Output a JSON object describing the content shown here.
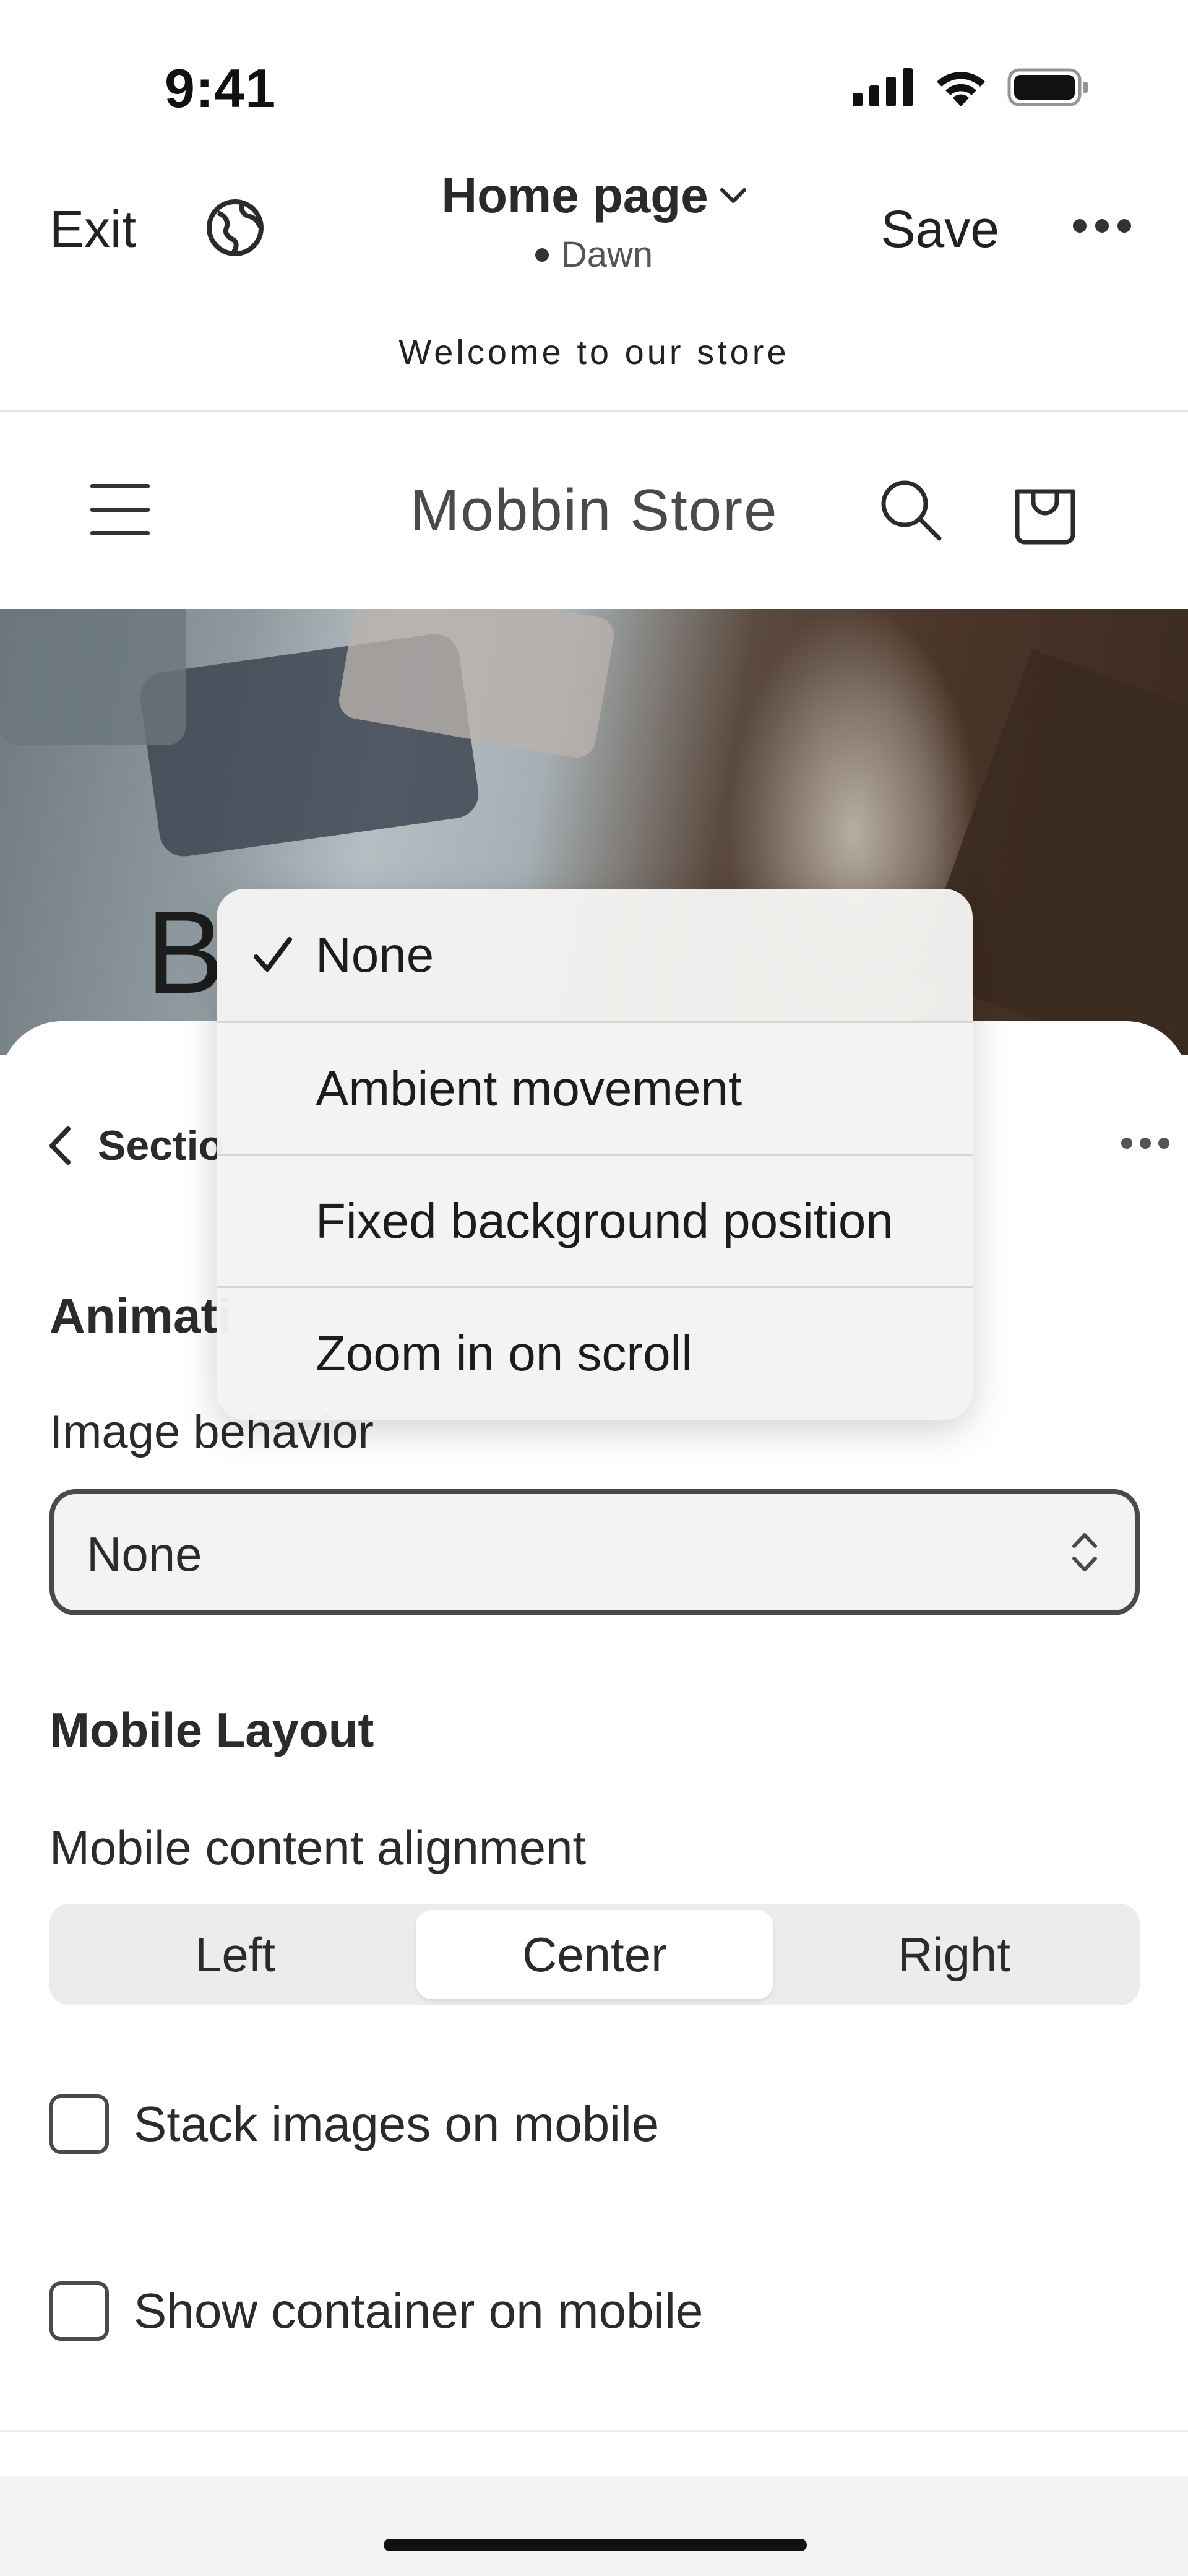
{
  "status_bar": {
    "time": "9:41"
  },
  "editor_bar": {
    "exit_label": "Exit",
    "page_title": "Home page",
    "theme_name": "Dawn",
    "save_label": "Save"
  },
  "store": {
    "announcement": "Welcome to our store",
    "name": "Mobbin Store",
    "hero_partial_text": "B"
  },
  "sheet": {
    "back_label": "Sectio",
    "animation_heading": "Animati",
    "image_behavior_label": "Image behavior",
    "image_behavior_value": "None",
    "mobile_layout_heading": "Mobile Layout",
    "mobile_alignment_label": "Mobile content alignment",
    "alignment_options": [
      "Left",
      "Center",
      "Right"
    ],
    "alignment_selected": "Center",
    "checkboxes": [
      {
        "label": "Stack images on mobile",
        "checked": false
      },
      {
        "label": "Show container on mobile",
        "checked": false
      }
    ]
  },
  "dropdown": {
    "selected": "None",
    "options": [
      "None",
      "Ambient movement",
      "Fixed background position",
      "Zoom in on scroll"
    ]
  },
  "icons": {
    "globe": "globe-icon",
    "chevron": "chevron-down-icon",
    "menu": "hamburger-icon",
    "search": "search-icon",
    "cart": "shopping-bag-icon",
    "back": "chevron-left-icon",
    "more": "more-horizontal-icon",
    "updown": "select-updown-icon",
    "check": "checkmark-icon"
  }
}
